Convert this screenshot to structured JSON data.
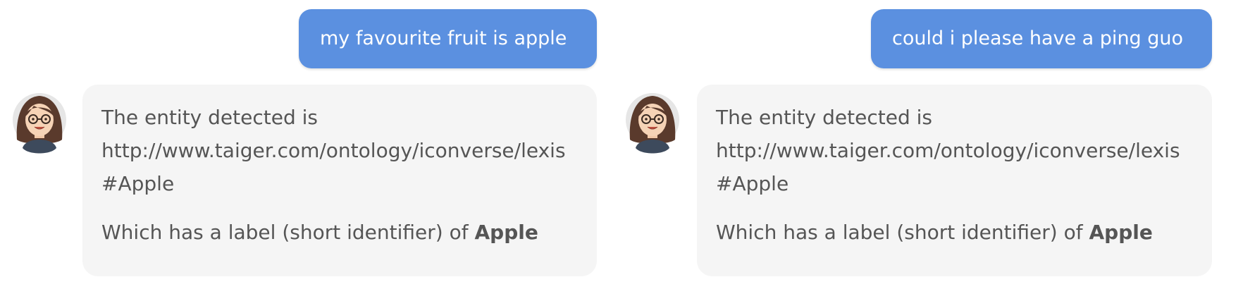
{
  "conversations": [
    {
      "user_message": "my favourite fruit is apple",
      "bot": {
        "line1": "The entity detected is",
        "url": "http://www.taiger.com/ontology/iconverse/lexis#Apple",
        "label_prefix": "Which has a label (short identifier) of ",
        "label_value": "Apple"
      }
    },
    {
      "user_message": "could i please have a ping guo",
      "bot": {
        "line1": "The entity detected is",
        "url": "http://www.taiger.com/ontology/iconverse/lexis#Apple",
        "label_prefix": "Which has a label (short identifier) of ",
        "label_value": "Apple"
      }
    }
  ],
  "colors": {
    "user_bubble": "#5b90e0",
    "bot_bubble": "#f5f5f5",
    "bot_text": "#555555"
  },
  "icons": {
    "avatar": "bot-avatar-woman-glasses"
  }
}
